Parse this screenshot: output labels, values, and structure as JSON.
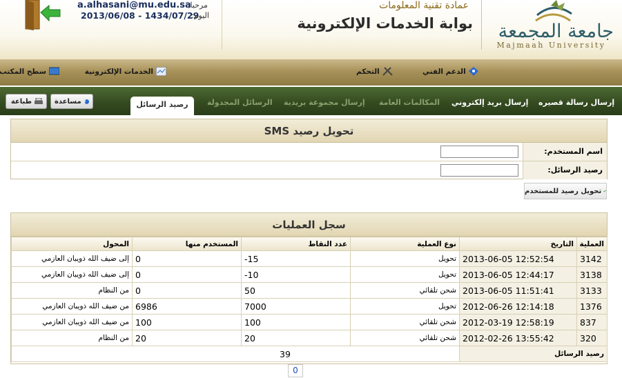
{
  "header": {
    "logo_ar": "جامعة المجمعة",
    "logo_en": "Majmaah University",
    "dept": "عمادة تقنية المعلومات",
    "portal_title": "بوابة الخدمات الإلكترونية",
    "greeting_label": "مرحبا,",
    "user_email": "a.alhasani@mu.edu.sa",
    "today_label": "اليوم:",
    "today_dates": "2013/06/08 - 1434/07/29"
  },
  "nav1": {
    "desktop": "سطح المكتب",
    "eservices": "الخدمات الإلكترونية",
    "support": "الدعم الفني",
    "control": "التحكم"
  },
  "nav2": {
    "send_sms": "إرسال رسالة قصيره",
    "send_email": "إرسال بريد إلكتروني",
    "tab3": "المكالمات العامة",
    "tab4": "إرسال مجموعة بريدية",
    "tab5": "الرسائل المجدولة",
    "active": "رصيد الرسائل",
    "help": "مساعدة",
    "print": "طباعة"
  },
  "form": {
    "title": "تحويل رصيد SMS",
    "username_label": "اسم المستخدم:",
    "balance_label": "رصيد الرسائل:",
    "submit": "تحويل رصيد للمستخدم"
  },
  "ops": {
    "title": "سجل العمليات",
    "headers": [
      "العملية",
      "التاريخ",
      "نوع العملية",
      "عدد النقاط",
      "المستخدم منها",
      "المحول"
    ],
    "rows": [
      [
        "3142",
        "2013-06-05 12:52:54",
        "تحويل",
        "-15",
        "0",
        "إلى ضيف الله ذويبان العازمي"
      ],
      [
        "3138",
        "2013-06-05 12:44:17",
        "تحويل",
        "-10",
        "0",
        "إلى ضيف الله ذويبان العازمي"
      ],
      [
        "3133",
        "2013-06-05 11:51:41",
        "شحن تلقائي",
        "50",
        "0",
        "من النظام"
      ],
      [
        "1376",
        "2012-06-26 12:14:18",
        "تحويل",
        "7000",
        "6986",
        "من ضيف الله ذويبان العازمي"
      ],
      [
        "837",
        "2012-03-19 12:58:19",
        "شحن تلقائي",
        "100",
        "100",
        "من ضيف الله ذويبان العازمي"
      ],
      [
        "320",
        "2012-02-26 13:55:42",
        "شحن تلقائي",
        "20",
        "20",
        "من النظام"
      ]
    ],
    "total_label": "رصيد الرسائل",
    "total_value": "39",
    "page": "0"
  }
}
